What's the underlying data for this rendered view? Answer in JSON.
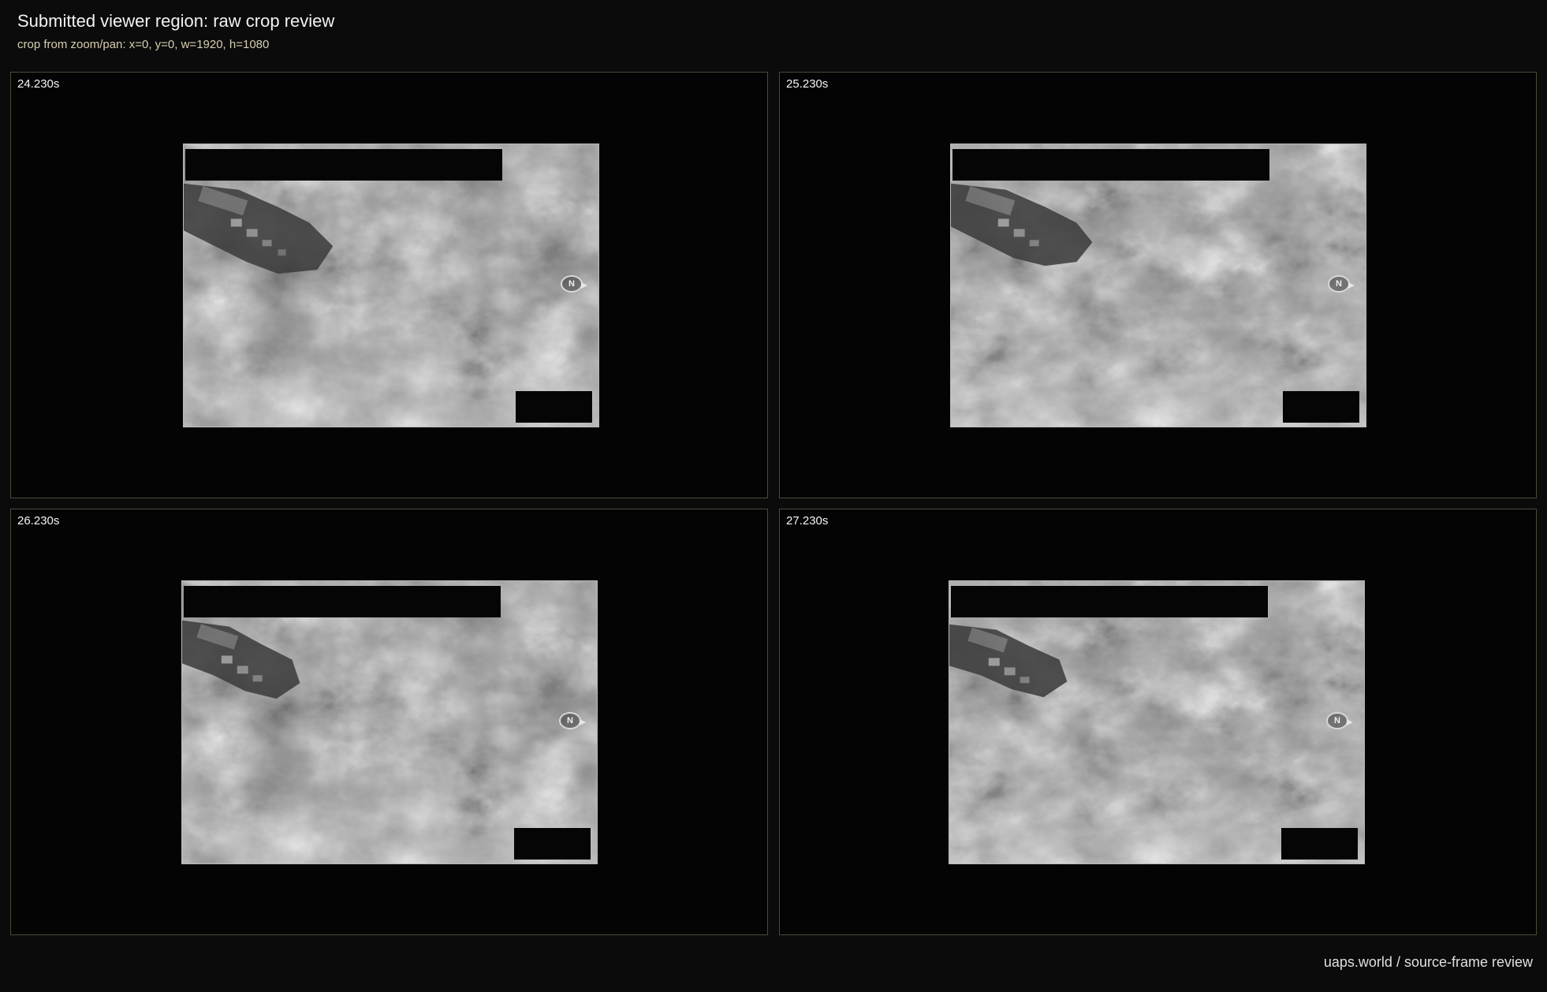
{
  "header": {
    "title": "Submitted viewer region: raw crop review",
    "subtitle": "crop from zoom/pan: x=0, y=0, w=1920, h=1080"
  },
  "panels": [
    {
      "timestamp": "24.230s",
      "compass_label": "N"
    },
    {
      "timestamp": "25.230s",
      "compass_label": "N"
    },
    {
      "timestamp": "26.230s",
      "compass_label": "N"
    },
    {
      "timestamp": "27.230s",
      "compass_label": "N"
    }
  ],
  "footer": {
    "credit": "uaps.world / source-frame review"
  },
  "colors": {
    "background": "#0b0b0b",
    "panel_border": "#4d4a3a",
    "subtitle": "#d7ceb0"
  }
}
